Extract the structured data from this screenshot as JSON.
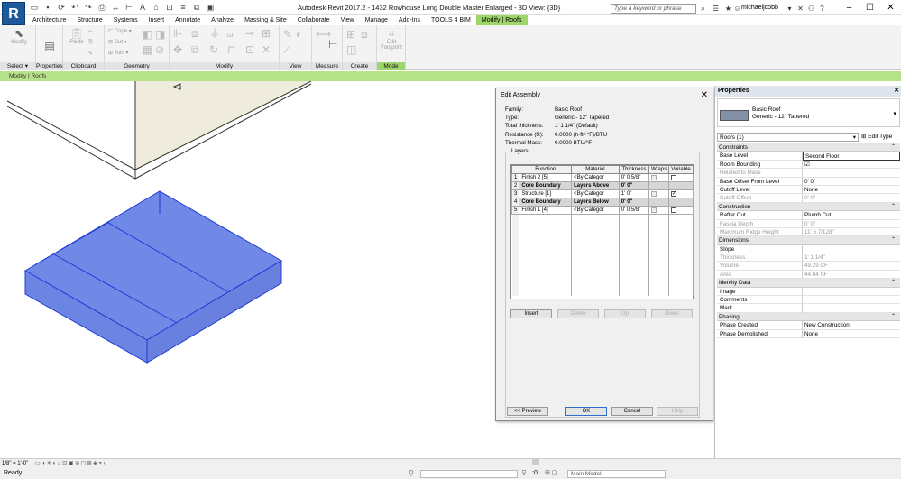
{
  "app": {
    "logo": "R",
    "title": "Autodesk Revit 2017.2 -     1432 Rowhouse Long Double Master Enlarged - 3D View: {3D}",
    "search_placeholder": "Type a keyword or phrase",
    "username": "michaeljcobb"
  },
  "tabs": [
    "Architecture",
    "Structure",
    "Systems",
    "Insert",
    "Annotate",
    "Analyze",
    "Massing & Site",
    "Collaborate",
    "View",
    "Manage",
    "Add-Ins",
    "TOOLS 4 BIM",
    "Modify | Roofs"
  ],
  "active_tab": "Modify | Roofs",
  "ribbon": {
    "modify_label": "Modify",
    "paste_label": "Paste",
    "cope_label": "Cope",
    "cut_label": "Cut",
    "join_label": "Join",
    "edit_footprint_label": "Edit Footprint",
    "panels": {
      "select": "Select",
      "properties": "Properties",
      "clipboard": "Clipboard",
      "geometry": "Geometry",
      "modify": "Modify",
      "view": "View",
      "measure": "Measure",
      "create": "Create",
      "mode": "Mode"
    }
  },
  "context_bar": "Modify | Roofs",
  "dialog": {
    "title": "Edit Assembly",
    "family_label": "Family:",
    "family_value": "Basic Roof",
    "type_label": "Type:",
    "type_value": "Generic - 12\" Tapered",
    "thickness_label": "Total thickness:",
    "thickness_value": "1'  1 1/4\" (Default)",
    "resistance_label": "Resistance (R):",
    "resistance_value": "0.0000 (h·ft²·°F)/BTU",
    "mass_label": "Thermal Mass:",
    "mass_value": "0.0000 BTU/°F",
    "layers_label": "Layers",
    "columns": [
      "",
      "Function",
      "Material",
      "Thickness",
      "Wraps",
      "Variable"
    ],
    "layers": [
      {
        "num": "1",
        "function": "Finish 2 [5]",
        "material": "<By Categor",
        "thickness": "0'  0 5/8\"",
        "core": false,
        "variable": false
      },
      {
        "num": "2",
        "function": "Core Boundary",
        "material": "Layers Above",
        "thickness": "0'  0\"",
        "core": true,
        "variable": null
      },
      {
        "num": "3",
        "function": "Structure [1]",
        "material": "<By Categor",
        "thickness": "1'  0\"",
        "core": false,
        "variable": true
      },
      {
        "num": "4",
        "function": "Core Boundary",
        "material": "Layers Below",
        "thickness": "0'  0\"",
        "core": true,
        "variable": null
      },
      {
        "num": "5",
        "function": "Finish 1 [4]",
        "material": "<By Categor",
        "thickness": "0'  0 5/8\"",
        "core": false,
        "variable": false
      }
    ],
    "buttons": {
      "insert": "Insert",
      "delete": "Delete",
      "up": "Up",
      "down": "Down",
      "preview": "<< Preview",
      "ok": "OK",
      "cancel": "Cancel",
      "help": "Help"
    }
  },
  "properties": {
    "title": "Properties",
    "family": "Basic Roof",
    "type": "Generic - 12\" Tapered",
    "instance": "Roofs (1)",
    "edit_type": "Edit Type",
    "sections": [
      {
        "name": "Constraints",
        "rows": [
          {
            "k": "Base Level",
            "v": "Second Floor",
            "ro": false,
            "hl": true
          },
          {
            "k": "Room Bounding",
            "v": "☑",
            "ro": false
          },
          {
            "k": "Related to Mass",
            "v": "",
            "ro": true
          },
          {
            "k": "Base Offset From Level",
            "v": "0'  0\"",
            "ro": false
          },
          {
            "k": "Cutoff Level",
            "v": "None",
            "ro": false
          },
          {
            "k": "Cutoff Offset",
            "v": "0'  0\"",
            "ro": true
          }
        ]
      },
      {
        "name": "Construction",
        "rows": [
          {
            "k": "Rafter Cut",
            "v": "Plumb Cut",
            "ro": false
          },
          {
            "k": "Fascia Depth",
            "v": "0'  0\"",
            "ro": true
          },
          {
            "k": "Maximum Ridge Height",
            "v": "11'  6 7/128\"",
            "ro": true
          }
        ]
      },
      {
        "name": "Dimensions",
        "rows": [
          {
            "k": "Slope",
            "v": "",
            "ro": false
          },
          {
            "k": "Thickness",
            "v": "1'  1 1/4\"",
            "ro": true
          },
          {
            "k": "Volume",
            "v": "49.29 CF",
            "ro": true
          },
          {
            "k": "Area",
            "v": "44.64 SF",
            "ro": true
          }
        ]
      },
      {
        "name": "Identity Data",
        "rows": [
          {
            "k": "Image",
            "v": "",
            "ro": false
          },
          {
            "k": "Comments",
            "v": "",
            "ro": false
          },
          {
            "k": "Mark",
            "v": "",
            "ro": false
          }
        ]
      },
      {
        "name": "Phasing",
        "rows": [
          {
            "k": "Phase Created",
            "v": "New Construction",
            "ro": false
          },
          {
            "k": "Phase Demolished",
            "v": "None",
            "ro": false
          }
        ]
      }
    ]
  },
  "statusbar": {
    "scale": "1/8\" = 1'-0\"",
    "status": "Ready",
    "selection_count": ":0",
    "model": "Main Model"
  },
  "colors": {
    "accent": "#9fd66c",
    "roof_fill": "#6f86e0",
    "roof_stroke": "#1f3bd6"
  }
}
